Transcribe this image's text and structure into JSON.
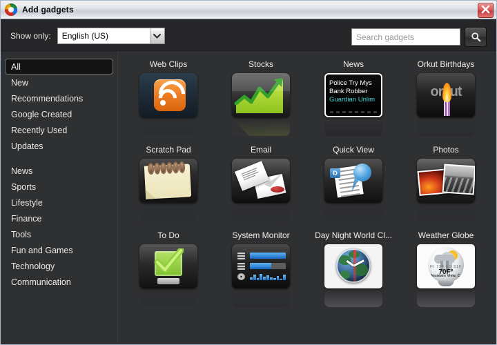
{
  "window": {
    "title": "Add gadgets",
    "logo_icon": "google-swirl-icon",
    "close_icon": "close-icon"
  },
  "toolbar": {
    "show_only_label": "Show only:",
    "language_value": "English (US)",
    "dropdown_icon": "chevron-down-icon",
    "search_placeholder": "Search gadgets",
    "search_value": "",
    "search_icon": "search-icon"
  },
  "sidebar": {
    "items": [
      {
        "label": "All",
        "selected": true
      },
      {
        "label": "New",
        "selected": false
      },
      {
        "label": "Recommendations",
        "selected": false
      },
      {
        "label": "Google Created",
        "selected": false
      },
      {
        "label": "Recently Used",
        "selected": false
      },
      {
        "label": "Updates",
        "selected": false
      }
    ],
    "categories": [
      {
        "label": "News"
      },
      {
        "label": "Sports"
      },
      {
        "label": "Lifestyle"
      },
      {
        "label": "Finance"
      },
      {
        "label": "Tools"
      },
      {
        "label": "Fun and Games"
      },
      {
        "label": "Technology"
      },
      {
        "label": "Communication"
      }
    ]
  },
  "gadgets": [
    {
      "title": "Web Clips",
      "art": "rss"
    },
    {
      "title": "Stocks",
      "art": "stocks"
    },
    {
      "title": "News",
      "art": "news"
    },
    {
      "title": "Orkut Birthdays",
      "art": "orkut"
    },
    {
      "title": "Scratch Pad",
      "art": "pad"
    },
    {
      "title": "Email",
      "art": "email"
    },
    {
      "title": "Quick View",
      "art": "quickview"
    },
    {
      "title": "Photos",
      "art": "photos"
    },
    {
      "title": "To Do",
      "art": "todo"
    },
    {
      "title": "System Monitor",
      "art": "sysmon"
    },
    {
      "title": "Day Night World Cl...",
      "art": "clock"
    },
    {
      "title": "Weather Globe",
      "art": "weather"
    }
  ],
  "news_preview": {
    "line1": "Police Try Mys",
    "line2": "Bank Robber",
    "source": "Guardian Unlim"
  },
  "orkut_preview": {
    "word": "orkut"
  },
  "quickview_preview": {
    "badge": "D"
  },
  "weather_preview": {
    "hi_lo": "HI 72F  LO 51F",
    "temperature": "70F°",
    "location": "Mountain View, CA"
  },
  "colors": {
    "background": "#2f3032",
    "toolbar": "#262628",
    "text": "#ededed",
    "accent_cyan": "#43d6d6",
    "close_red": "#d24343"
  }
}
